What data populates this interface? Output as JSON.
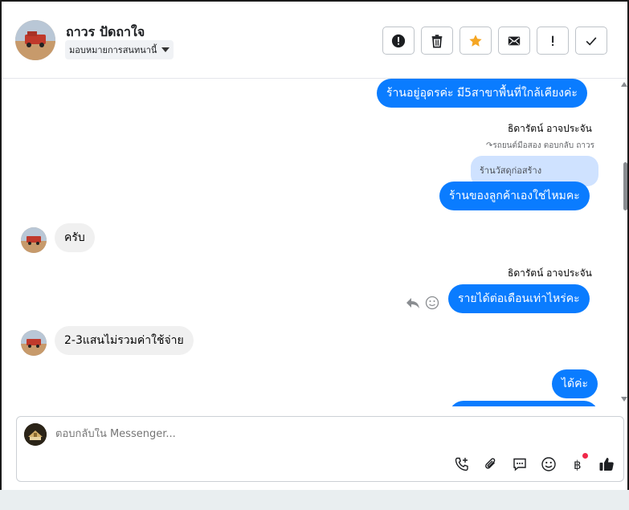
{
  "header": {
    "contact_name": "ถาวร ปัดถาใจ",
    "assign_label": "มอบหมายการสนทนานี้",
    "actions": [
      {
        "icon": "alert-circle-icon",
        "name": "mark-spam-button"
      },
      {
        "icon": "trash-icon",
        "name": "delete-button"
      },
      {
        "icon": "star-icon",
        "name": "star-button",
        "color": "#f5a623"
      },
      {
        "icon": "envelope-icon",
        "name": "mark-unread-button"
      },
      {
        "icon": "exclamation-icon",
        "name": "follow-up-button"
      },
      {
        "icon": "checkmark-icon",
        "name": "mark-done-button"
      }
    ]
  },
  "messages": {
    "m1": "ร้านอยู่อุดรค่ะ มี5สาขาพื้นที่ใกล้เคียงค่ะ",
    "sender1": "ธิดารัตน์ อาจประจัน",
    "reply_note": "รถยนต์มือสอง ตอบกลับ ถาวร",
    "quoted": "ร้านวัสดุก่อสร้าง",
    "m2": "ร้านของลูกค้าเองใช่ไหมคะ",
    "in1": "ครับ",
    "sender2": "ธิดารัตน์ อาจประจัน",
    "m3": "รายได้ต่อเดือนเท่าไหร่คะ",
    "in2": "2-3แสนไม่รวมค่าใช้จ่าย",
    "m4": "ได้ค่ะ"
  },
  "composer": {
    "placeholder": "ตอบกลับใน Messenger...",
    "tools": [
      "call-icon",
      "paperclip-icon",
      "saved-reply-icon",
      "emoji-icon",
      "baht-icon",
      "thumbs-up-icon"
    ]
  },
  "colors": {
    "outgoing": "#0a7cff",
    "incoming": "#f0f0f0",
    "quoted": "#cfe2ff",
    "notification_dot": "#f02849"
  }
}
